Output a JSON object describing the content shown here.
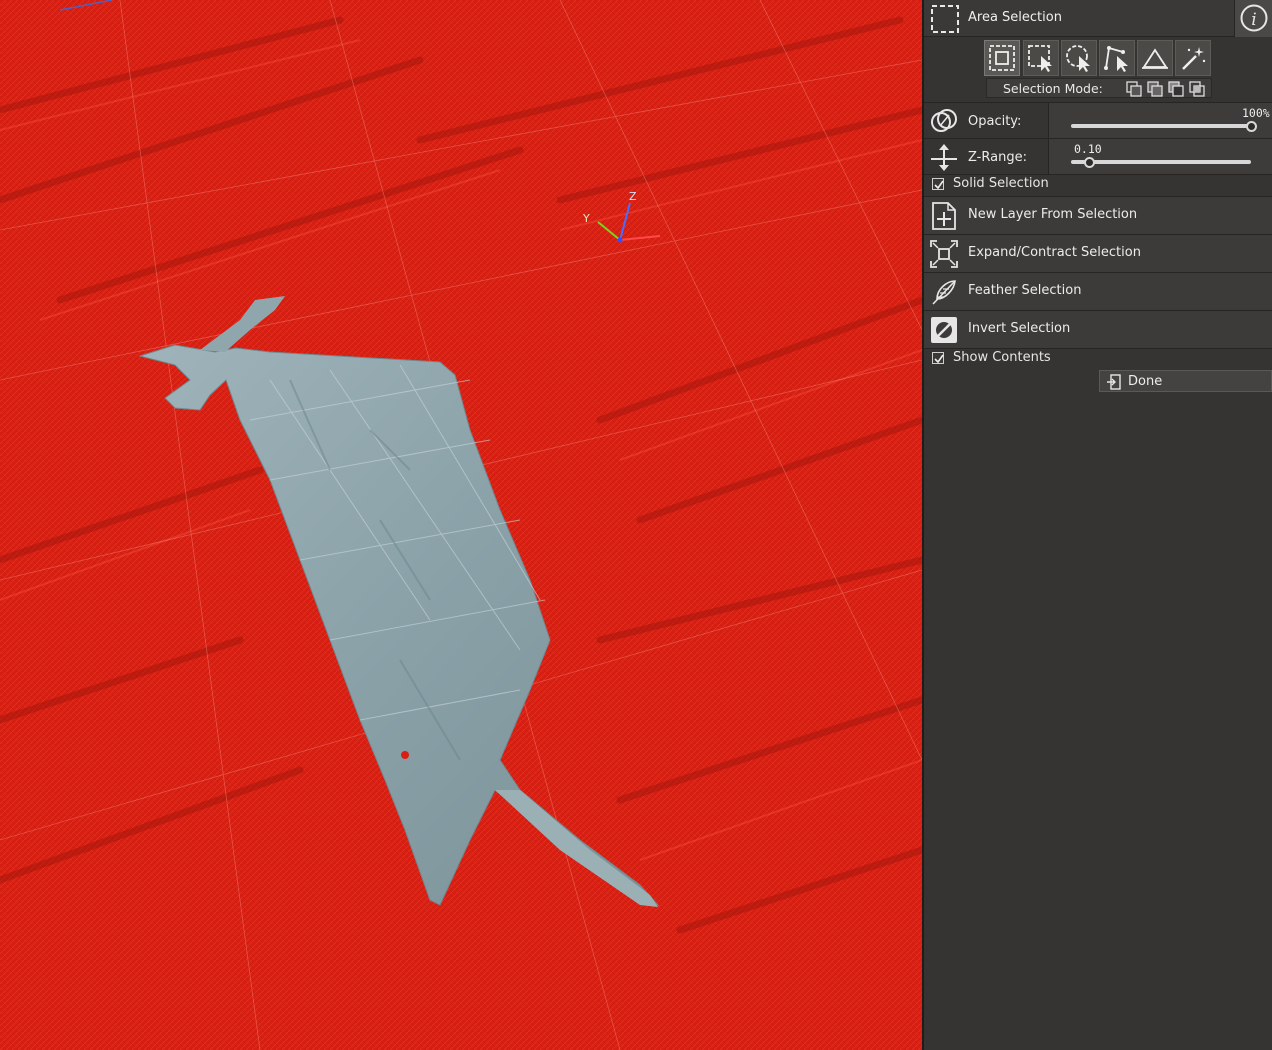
{
  "viewport": {
    "axes": {
      "x_label": "",
      "y_label": "Y",
      "z_label": "Z"
    },
    "colors": {
      "selection_overlay": "#d81f12",
      "unselected_terrain": "#8ea5ab"
    }
  },
  "panel": {
    "title": "Area Selection",
    "info_icon": "info-icon",
    "tools": [
      {
        "name": "select-all-icon",
        "active": true
      },
      {
        "name": "rectangle-select-icon",
        "active": false
      },
      {
        "name": "lasso-select-icon",
        "active": false
      },
      {
        "name": "polygon-select-icon",
        "active": false
      },
      {
        "name": "height-select-icon",
        "active": false
      },
      {
        "name": "magic-wand-icon",
        "active": false
      }
    ],
    "selection_mode": {
      "label": "Selection Mode:",
      "modes": [
        "replace-mode-icon",
        "add-mode-icon",
        "subtract-mode-icon",
        "intersect-mode-icon"
      ]
    },
    "opacity": {
      "label": "Opacity:",
      "value_text": "100%",
      "fraction": 1.0
    },
    "z_range": {
      "label": "Z-Range:",
      "value_text": "0.10",
      "fraction": 0.1
    },
    "solid_selection": {
      "label": "Solid Selection",
      "checked": true
    },
    "actions": [
      {
        "label": "New Layer From Selection",
        "icon": "new-layer-icon"
      },
      {
        "label": "Expand/Contract Selection",
        "icon": "expand-contract-icon"
      },
      {
        "label": "Feather Selection",
        "icon": "feather-icon"
      },
      {
        "label": "Invert Selection",
        "icon": "invert-icon"
      }
    ],
    "show_contents": {
      "label": "Show Contents",
      "checked": true
    },
    "done": {
      "label": "Done"
    }
  }
}
